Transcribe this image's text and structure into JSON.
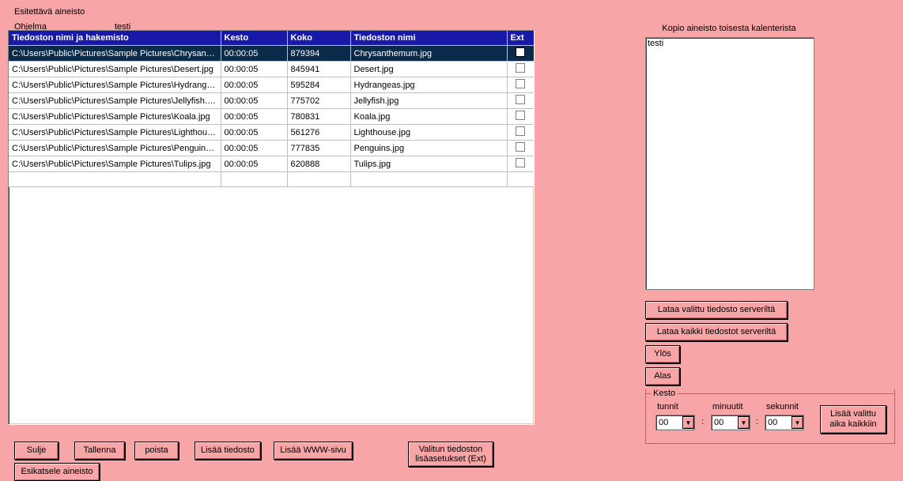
{
  "title": "Esitettävä aineisto",
  "program_label": "Ohjelma",
  "program_name": "testi",
  "columns": {
    "path": "Tiedoston nimi ja hakemisto",
    "kesto": "Kesto",
    "koko": "Koko",
    "nimi": "Tiedoston nimi",
    "ext": "Ext"
  },
  "rows": [
    {
      "path": "C:\\Users\\Public\\Pictures\\Sample Pictures\\Chrysanth...",
      "kesto": "00:00:05",
      "koko": "879394",
      "nimi": "Chrysanthemum.jpg",
      "selected": true
    },
    {
      "path": "C:\\Users\\Public\\Pictures\\Sample Pictures\\Desert.jpg",
      "kesto": "00:00:05",
      "koko": "845941",
      "nimi": "Desert.jpg"
    },
    {
      "path": "C:\\Users\\Public\\Pictures\\Sample Pictures\\Hydrange...",
      "kesto": "00:00:05",
      "koko": "595284",
      "nimi": "Hydrangeas.jpg"
    },
    {
      "path": "C:\\Users\\Public\\Pictures\\Sample Pictures\\Jellyfish.jpg",
      "kesto": "00:00:05",
      "koko": "775702",
      "nimi": "Jellyfish.jpg"
    },
    {
      "path": "C:\\Users\\Public\\Pictures\\Sample Pictures\\Koala.jpg",
      "kesto": "00:00:05",
      "koko": "780831",
      "nimi": "Koala.jpg"
    },
    {
      "path": "C:\\Users\\Public\\Pictures\\Sample Pictures\\Lighthous...",
      "kesto": "00:00:05",
      "koko": "561276",
      "nimi": "Lighthouse.jpg"
    },
    {
      "path": "C:\\Users\\Public\\Pictures\\Sample Pictures\\Penguins....",
      "kesto": "00:00:05",
      "koko": "777835",
      "nimi": "Penguins.jpg"
    },
    {
      "path": "C:\\Users\\Public\\Pictures\\Sample Pictures\\Tulips.jpg",
      "kesto": "00:00:05",
      "koko": "620888",
      "nimi": "Tulips.jpg"
    },
    {
      "path": "",
      "kesto": "",
      "koko": "",
      "nimi": "",
      "empty": true
    }
  ],
  "buttons": {
    "sulje": "Sulje",
    "tallenna": "Tallenna",
    "poista": "poista",
    "lisaa_tiedosto": "Lisää tiedosto",
    "lisaa_www": "Lisää WWW-sivu",
    "valitun_line1": "Valitun tiedoston",
    "valitun_line2": "lisäasetukset (Ext)",
    "esikatsele": "Esikatsele aineisto"
  },
  "right": {
    "title": "Kopio aineisto toisesta kalenterista",
    "list_item": "testi",
    "lataa_valittu": "Lataa valittu tiedosto serveriltä",
    "lataa_kaikki": "Lataa kaikki tiedostot serveriltä",
    "ylos": "Ylös",
    "alas": "Alas"
  },
  "kesto": {
    "legend": "Kesto",
    "tunnit_label": "tunnit",
    "minuutit_label": "minuutit",
    "sekunnit_label": "sekunnit",
    "tunnit": "00",
    "minuutit": "00",
    "sekunnit": "00",
    "lisaa_line1": "Lisää valittu",
    "lisaa_line2": "aika kaikkiin"
  }
}
